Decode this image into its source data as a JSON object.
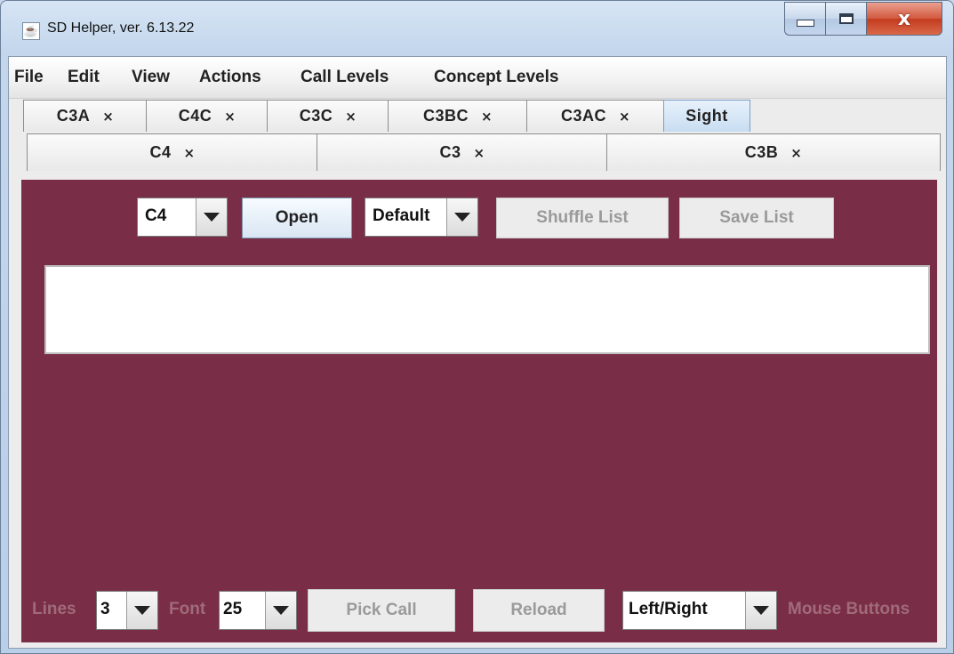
{
  "window": {
    "title": "SD Helper, ver. 6.13.22",
    "close_glyph": "x"
  },
  "menu": [
    "File",
    "Edit",
    "View",
    "Actions",
    "Call Levels",
    "Concept Levels"
  ],
  "tabs_row1": [
    {
      "label": "C3A",
      "close": "×"
    },
    {
      "label": "C4C",
      "close": "×"
    },
    {
      "label": "C3C",
      "close": "×"
    },
    {
      "label": "C3BC",
      "close": "×"
    },
    {
      "label": "C3AC",
      "close": "×"
    },
    {
      "label": "Sight",
      "close": "",
      "selected": true
    }
  ],
  "tabs_row2": [
    {
      "label": "C4",
      "close": "×"
    },
    {
      "label": "C3",
      "close": "×"
    },
    {
      "label": "C3B",
      "close": "×"
    }
  ],
  "top_controls": {
    "level_select": "C4",
    "open_label": "Open",
    "order_select": "Default",
    "shuffle_label": "Shuffle List",
    "save_label": "Save List"
  },
  "call_text": "",
  "bottom_controls": {
    "lines_label": "Lines",
    "lines_value": "3",
    "font_label": "Font",
    "font_value": "25",
    "pick_call_label": "Pick Call",
    "reload_label": "Reload",
    "mouse_select": "Left/Right",
    "mouse_label": "Mouse Buttons"
  },
  "colors": {
    "panel": "#7a2d46",
    "disabled_text": "#9a9a9a",
    "muted_label": "#9f6b7b",
    "selected_tab": "#c8ddf2"
  },
  "icons": {
    "app": "java-icon",
    "dropdown": "triangle-down-icon",
    "tab_close": "close-x-icon"
  }
}
